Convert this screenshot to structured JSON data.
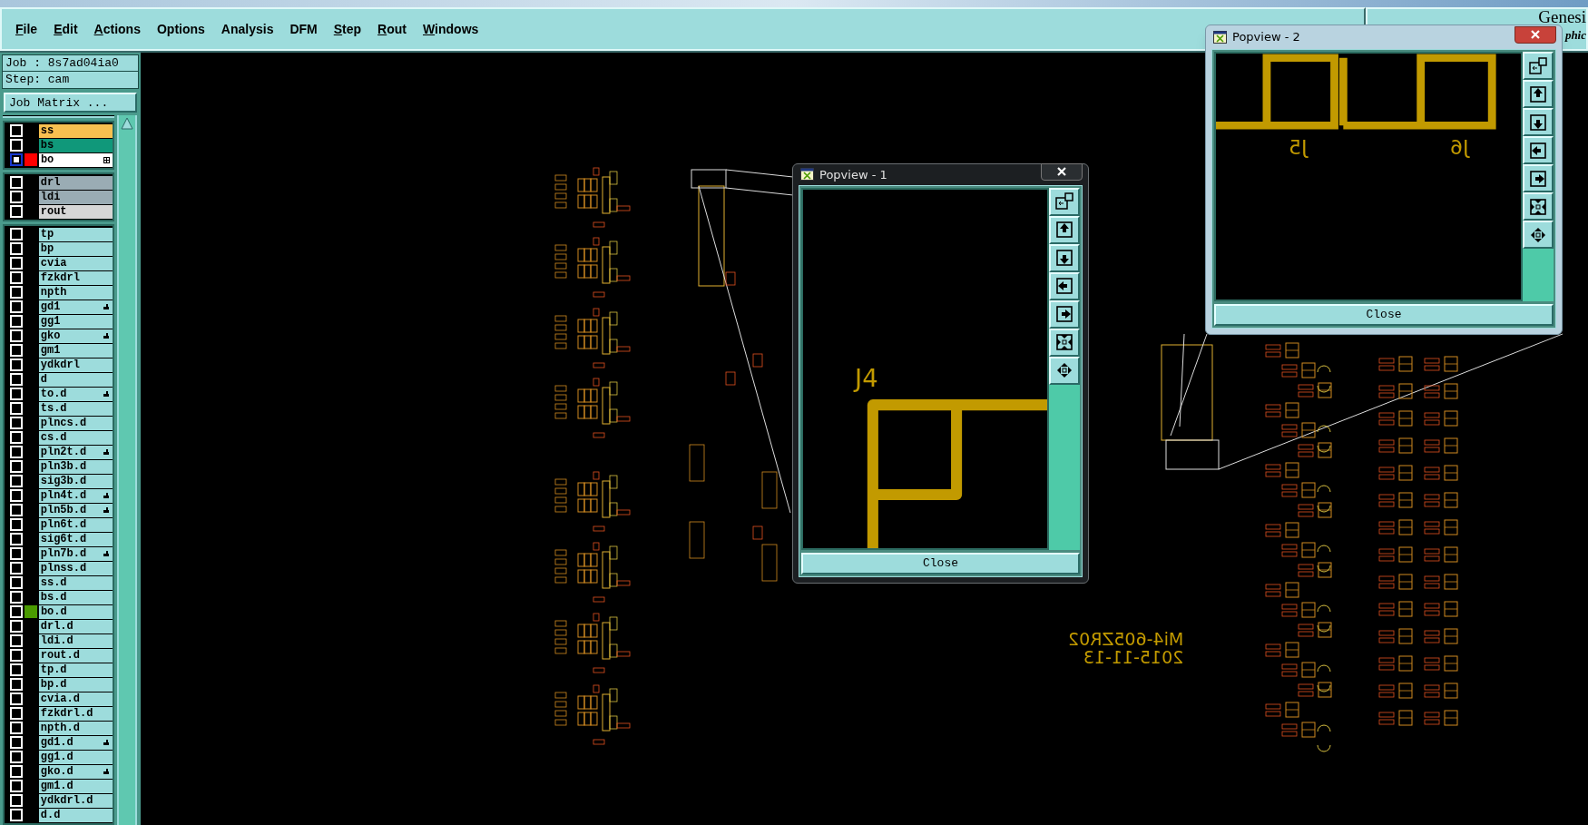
{
  "menu": [
    {
      "label": "File",
      "underline": true
    },
    {
      "label": "Edit",
      "underline": true
    },
    {
      "label": "Actions",
      "underline": true
    },
    {
      "label": "Options",
      "underline": false
    },
    {
      "label": "Analysis",
      "underline": false
    },
    {
      "label": "DFM",
      "underline": false
    },
    {
      "label": "Step",
      "underline": true
    },
    {
      "label": "Rout",
      "underline": true
    },
    {
      "label": "Windows",
      "underline": true
    }
  ],
  "brand": {
    "title": "Genesi",
    "subtitle": "phic"
  },
  "job": {
    "job": "Job : 8s7ad04ia0",
    "step": "Step: cam",
    "matrix_button": "Job Matrix ..."
  },
  "layer_groups": [
    [
      {
        "name": "ss",
        "color": "#f8c050",
        "active": false,
        "kind": "plain"
      },
      {
        "name": "bs",
        "color": "#10987a",
        "active": false,
        "kind": "plain"
      },
      {
        "name": "bo",
        "color": "#ffffff",
        "active": true,
        "swatch": {
          "color": "#ff0000"
        },
        "kind": "grid"
      }
    ],
    [
      {
        "name": "drl",
        "color": "#9aacb4",
        "active": false,
        "kind": "plain"
      },
      {
        "name": "ldi",
        "color": "#9aacb4",
        "active": false,
        "kind": "plain"
      },
      {
        "name": "rout",
        "color": "#d6d6d6",
        "active": false,
        "kind": "plain"
      }
    ],
    [
      {
        "name": "tp",
        "color": "#9ddcdc",
        "active": false,
        "kind": "plain"
      },
      {
        "name": "bp",
        "color": "#9ddcdc",
        "active": false,
        "kind": "plain"
      },
      {
        "name": "cvia",
        "color": "#9ddcdc",
        "active": false,
        "kind": "plain"
      },
      {
        "name": "fzkdrl",
        "color": "#9ddcdc",
        "active": false,
        "kind": "plain"
      },
      {
        "name": "npth",
        "color": "#9ddcdc",
        "active": false,
        "kind": "plain"
      },
      {
        "name": "gd1",
        "color": "#9ddcdc",
        "active": false,
        "kind": "hand"
      },
      {
        "name": "gg1",
        "color": "#9ddcdc",
        "active": false,
        "kind": "plain"
      },
      {
        "name": "gko",
        "color": "#9ddcdc",
        "active": false,
        "kind": "hand"
      },
      {
        "name": "gm1",
        "color": "#9ddcdc",
        "active": false,
        "kind": "plain"
      },
      {
        "name": "ydkdrl",
        "color": "#9ddcdc",
        "active": false,
        "kind": "plain"
      },
      {
        "name": "d",
        "color": "#9ddcdc",
        "active": false,
        "kind": "plain"
      },
      {
        "name": "to.d",
        "color": "#9ddcdc",
        "active": false,
        "kind": "hand"
      },
      {
        "name": "ts.d",
        "color": "#9ddcdc",
        "active": false,
        "kind": "plain"
      },
      {
        "name": "plncs.d",
        "color": "#9ddcdc",
        "active": false,
        "kind": "plain"
      },
      {
        "name": "cs.d",
        "color": "#9ddcdc",
        "active": false,
        "kind": "plain"
      },
      {
        "name": "pln2t.d",
        "color": "#9ddcdc",
        "active": false,
        "kind": "hand"
      },
      {
        "name": "pln3b.d",
        "color": "#9ddcdc",
        "active": false,
        "kind": "plain"
      },
      {
        "name": "sig3b.d",
        "color": "#9ddcdc",
        "active": false,
        "kind": "plain"
      },
      {
        "name": "pln4t.d",
        "color": "#9ddcdc",
        "active": false,
        "kind": "hand"
      },
      {
        "name": "pln5b.d",
        "color": "#9ddcdc",
        "active": false,
        "kind": "hand"
      },
      {
        "name": "pln6t.d",
        "color": "#9ddcdc",
        "active": false,
        "kind": "plain"
      },
      {
        "name": "sig6t.d",
        "color": "#9ddcdc",
        "active": false,
        "kind": "plain"
      },
      {
        "name": "pln7b.d",
        "color": "#9ddcdc",
        "active": false,
        "kind": "hand"
      },
      {
        "name": "plnss.d",
        "color": "#9ddcdc",
        "active": false,
        "kind": "plain"
      },
      {
        "name": "ss.d",
        "color": "#9ddcdc",
        "active": false,
        "kind": "plain"
      },
      {
        "name": "bs.d",
        "color": "#9ddcdc",
        "active": false,
        "kind": "plain"
      },
      {
        "name": "bo.d",
        "color": "#9ddcdc",
        "active": false,
        "swatch": {
          "color": "#4a9a00"
        },
        "kind": "plain"
      },
      {
        "name": "drl.d",
        "color": "#9ddcdc",
        "active": false,
        "kind": "plain"
      },
      {
        "name": "ldi.d",
        "color": "#9ddcdc",
        "active": false,
        "kind": "plain"
      },
      {
        "name": "rout.d",
        "color": "#9ddcdc",
        "active": false,
        "kind": "plain"
      },
      {
        "name": "tp.d",
        "color": "#9ddcdc",
        "active": false,
        "kind": "plain"
      },
      {
        "name": "bp.d",
        "color": "#9ddcdc",
        "active": false,
        "kind": "plain"
      },
      {
        "name": "cvia.d",
        "color": "#9ddcdc",
        "active": false,
        "kind": "plain"
      },
      {
        "name": "fzkdrl.d",
        "color": "#9ddcdc",
        "active": false,
        "kind": "plain"
      },
      {
        "name": "npth.d",
        "color": "#9ddcdc",
        "active": false,
        "kind": "plain"
      },
      {
        "name": "gd1.d",
        "color": "#9ddcdc",
        "active": false,
        "kind": "hand"
      },
      {
        "name": "gg1.d",
        "color": "#9ddcdc",
        "active": false,
        "kind": "plain"
      },
      {
        "name": "gko.d",
        "color": "#9ddcdc",
        "active": false,
        "kind": "hand"
      },
      {
        "name": "gm1.d",
        "color": "#9ddcdc",
        "active": false,
        "kind": "plain"
      },
      {
        "name": "ydkdrl.d",
        "color": "#9ddcdc",
        "active": false,
        "kind": "plain"
      },
      {
        "name": "d.d",
        "color": "#9ddcdc",
        "active": false,
        "kind": "plain"
      }
    ]
  ],
  "board": {
    "labels": [
      "Mi4-605ZR02",
      "2015-11-13"
    ]
  },
  "popviews": [
    {
      "title": "Popview - 1",
      "dark": true,
      "kind": "single",
      "designators": [
        "J4"
      ],
      "close": "Close",
      "tools": [
        {
          "kind": "popout"
        },
        {
          "kind": "up"
        },
        {
          "kind": "down"
        },
        {
          "kind": "left"
        },
        {
          "kind": "right"
        },
        {
          "kind": "fit"
        },
        {
          "kind": "pan"
        }
      ]
    },
    {
      "title": "Popview - 2",
      "dark": false,
      "kind": "pair",
      "designators": [
        "J5",
        "J6"
      ],
      "close": "Close",
      "tools": [
        {
          "kind": "popout"
        },
        {
          "kind": "up"
        },
        {
          "kind": "down"
        },
        {
          "kind": "left"
        },
        {
          "kind": "right"
        },
        {
          "kind": "fit"
        },
        {
          "kind": "pan"
        }
      ]
    }
  ]
}
